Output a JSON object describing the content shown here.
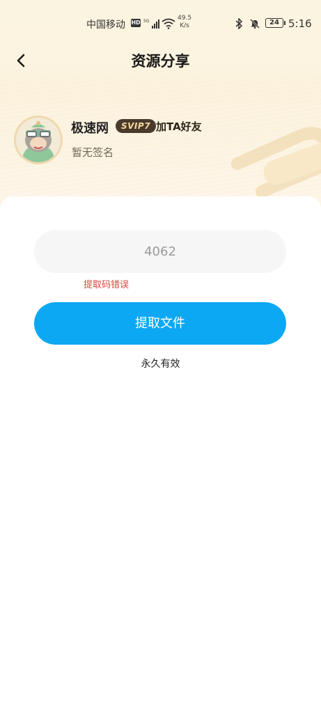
{
  "status_bar": {
    "carrier": "中国移动",
    "hd": "HD",
    "net_speed_value": "49.5",
    "net_speed_unit": "K/s",
    "battery": "24",
    "time": "5:16"
  },
  "header": {
    "title": "资源分享"
  },
  "profile": {
    "name": "极速网",
    "vip_badge": "SVIP7",
    "add_friend": "加TA好友",
    "signature": "暂无签名"
  },
  "extract": {
    "code_value": "4062",
    "error_text": "提取码错误",
    "button_label": "提取文件",
    "validity_text": "永久有效"
  },
  "colors": {
    "accent": "#0da8f4",
    "error": "#d9473a",
    "vip_bg": "#4a3a2c",
    "vip_text": "#f6d9a2"
  }
}
